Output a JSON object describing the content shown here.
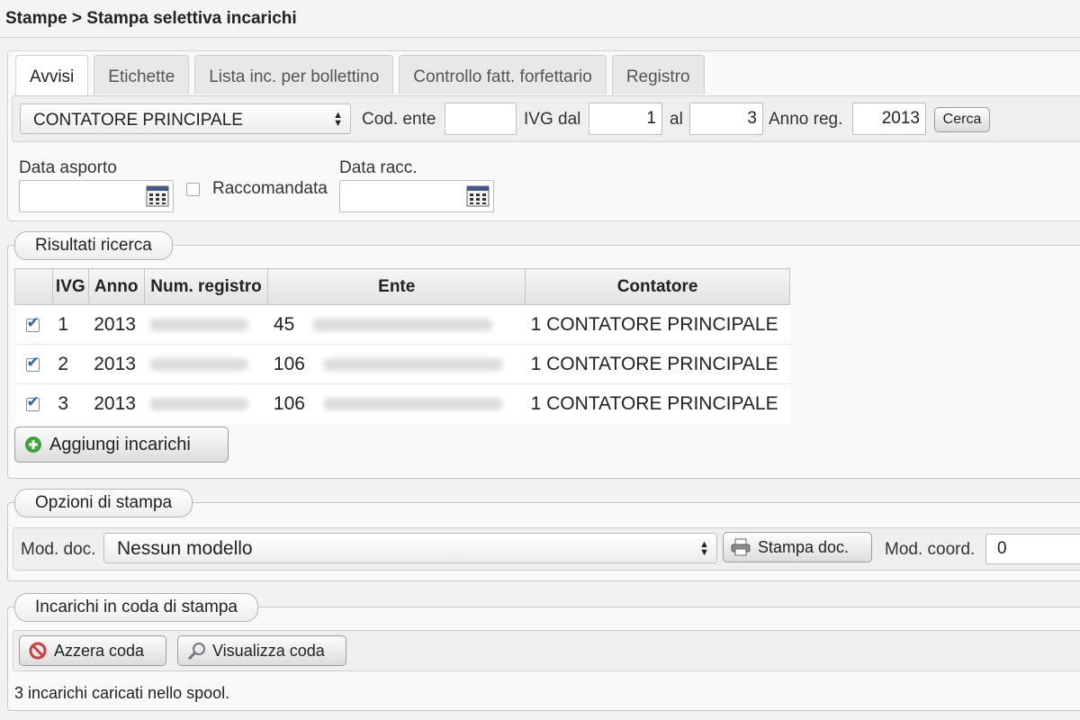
{
  "breadcrumb": "Stampe > Stampa selettiva incarichi",
  "tabs": [
    "Avvisi",
    "Etichette",
    "Lista inc. per bollettino",
    "Controllo fatt. forfettario",
    "Registro"
  ],
  "filters": {
    "contatore_select": "CONTATORE PRINCIPALE",
    "cod_ente_label": "Cod. ente",
    "cod_ente_value": "",
    "ivg_dal_label": "IVG dal",
    "ivg_dal_value": "1",
    "al_label": "al",
    "al_value": "3",
    "anno_reg_label": "Anno reg.",
    "anno_reg_value": "2013",
    "cerca_button": "Cerca",
    "data_asporto_label": "Data asporto",
    "raccomandata_label": "Raccomandata",
    "data_racc_label": "Data racc."
  },
  "results": {
    "legend": "Risultati ricerca",
    "columns": [
      "IVG",
      "Anno",
      "Num. registro",
      "Ente",
      "Contatore"
    ],
    "rows": [
      {
        "ivg": "1",
        "anno": "2013",
        "ente_code": "45",
        "contatore": "1  CONTATORE PRINCIPALE"
      },
      {
        "ivg": "2",
        "anno": "2013",
        "ente_code": "106",
        "contatore": "1  CONTATORE PRINCIPALE"
      },
      {
        "ivg": "3",
        "anno": "2013",
        "ente_code": "106",
        "contatore": "1  CONTATORE PRINCIPALE"
      }
    ],
    "add_button": "Aggiungi incarichi"
  },
  "print_options": {
    "legend": "Opzioni di stampa",
    "mod_doc_label": "Mod. doc.",
    "mod_doc_value": "Nessun modello",
    "stampa_button": "Stampa doc.",
    "mod_coord_label": "Mod. coord.",
    "mod_coord_value": "0"
  },
  "queue": {
    "legend": "Incarichi in coda di stampa",
    "azzera_button": "Azzera coda",
    "visualizza_button": "Visualizza coda",
    "status": "3 incarichi caricati nello spool."
  },
  "colors": {
    "accent_green": "#3aa63a",
    "stop_red": "#d23c3c",
    "check_blue": "#2f5fb3"
  }
}
